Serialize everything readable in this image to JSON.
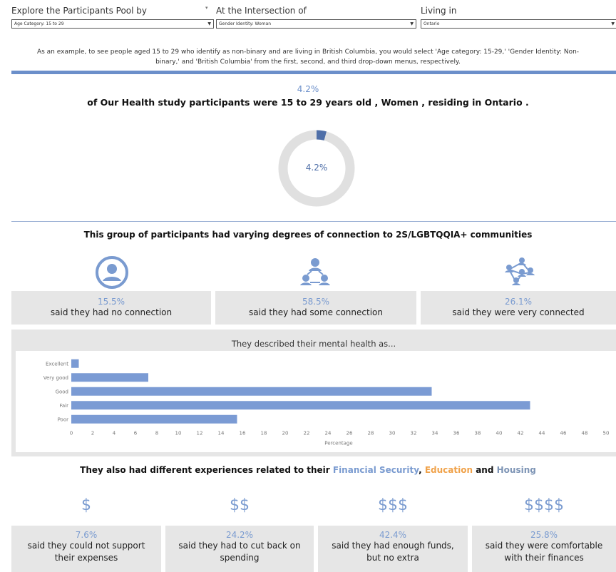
{
  "filters": {
    "participants": {
      "label": "Explore the Participants Pool by",
      "value": "Age Category: 15 to 29"
    },
    "intersection": {
      "label": "At the Intersection of",
      "value": "Gender Identity: Woman"
    },
    "living": {
      "label": "Living in",
      "value": "Ontario"
    }
  },
  "example": {
    "line1": "As an example, to see people aged 15 to 29 who identify as non-binary and are living in British Columbia, you would select 'Age category: 15-29,' 'Gender Identity: Non-",
    "line2": "binary,' and 'British Columbia' from the first, second, and third drop-down menus, respectively."
  },
  "summary": {
    "pct": "4.2%",
    "text": "of Our Health study participants were 15 to 29 years old , Women , residing in Ontario .",
    "donut_label": "4.2%",
    "donut_fraction": 0.042
  },
  "connection": {
    "heading": "This group of participants had varying degrees of connection to 2S/LGBTQQIA+ communities",
    "items": [
      {
        "icon": "person-circle-icon",
        "pct": "15.5%",
        "text": "said they had no connection"
      },
      {
        "icon": "people-network-icon",
        "pct": "58.5%",
        "text": "said they had some connection"
      },
      {
        "icon": "people-web-icon",
        "pct": "26.1%",
        "text": "said they were very connected"
      }
    ]
  },
  "chart_data": {
    "type": "bar",
    "orientation": "horizontal",
    "title": "They described their mental health as...",
    "xlabel": "Percentage",
    "categories": [
      "Excellent",
      "Very good",
      "Good",
      "Fair",
      "Poor"
    ],
    "values": [
      0.7,
      7.2,
      33.7,
      42.9,
      15.5
    ],
    "xlim": [
      0,
      50
    ],
    "xticks": [
      0,
      2,
      4,
      6,
      8,
      10,
      12,
      14,
      16,
      18,
      20,
      22,
      24,
      26,
      28,
      30,
      32,
      34,
      36,
      38,
      40,
      42,
      44,
      46,
      48,
      50
    ],
    "bar_color": "#7b9bd4"
  },
  "experiences": {
    "heading_pre": "They also had different experiences related to their ",
    "financial": "Financial Security",
    "comma": ", ",
    "education": "Education",
    "and": " and ",
    "housing": "Housing",
    "colors": {
      "financial": "#7a9bd0",
      "education": "#f0a24a",
      "housing": "#7d94b5"
    },
    "items": [
      {
        "symbol": "$",
        "pct": "7.6%",
        "line1": "said they could not support",
        "line2": "their expenses"
      },
      {
        "symbol": "$$",
        "pct": "24.2%",
        "line1": "said they had to cut back on",
        "line2": "spending"
      },
      {
        "symbol": "$$$",
        "pct": "42.4%",
        "line1": "said they had enough funds,",
        "line2": "but no extra"
      },
      {
        "symbol": "$$$$",
        "pct": "25.8%",
        "line1": "said they were comfortable",
        "line2": "with their finances"
      }
    ]
  }
}
